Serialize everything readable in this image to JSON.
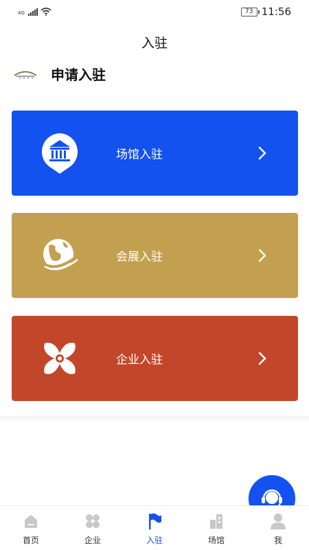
{
  "status_bar": {
    "network": "4G",
    "battery": "73",
    "time": "11:56"
  },
  "nav": {
    "title": "入驻"
  },
  "header": {
    "title": "申请入驻"
  },
  "cards": [
    {
      "label": "场馆入驻",
      "color": "#1452ef",
      "icon": "museum-pin-icon"
    },
    {
      "label": "会展入驻",
      "color": "#c39f50",
      "icon": "globe-icon"
    },
    {
      "label": "企业入驻",
      "color": "#c2472a",
      "icon": "flower-icon"
    }
  ],
  "support": {
    "icon": "headset-icon"
  },
  "tabs": [
    {
      "label": "首页",
      "icon": "home-icon",
      "active": false
    },
    {
      "label": "企业",
      "icon": "grid-icon",
      "active": false
    },
    {
      "label": "入驻",
      "icon": "flag-icon",
      "active": true
    },
    {
      "label": "场馆",
      "icon": "building-icon",
      "active": false
    },
    {
      "label": "我",
      "icon": "person-icon",
      "active": false
    }
  ],
  "colors": {
    "accent": "#1452ef",
    "inactive_tab_icon": "#c8c8c8"
  }
}
